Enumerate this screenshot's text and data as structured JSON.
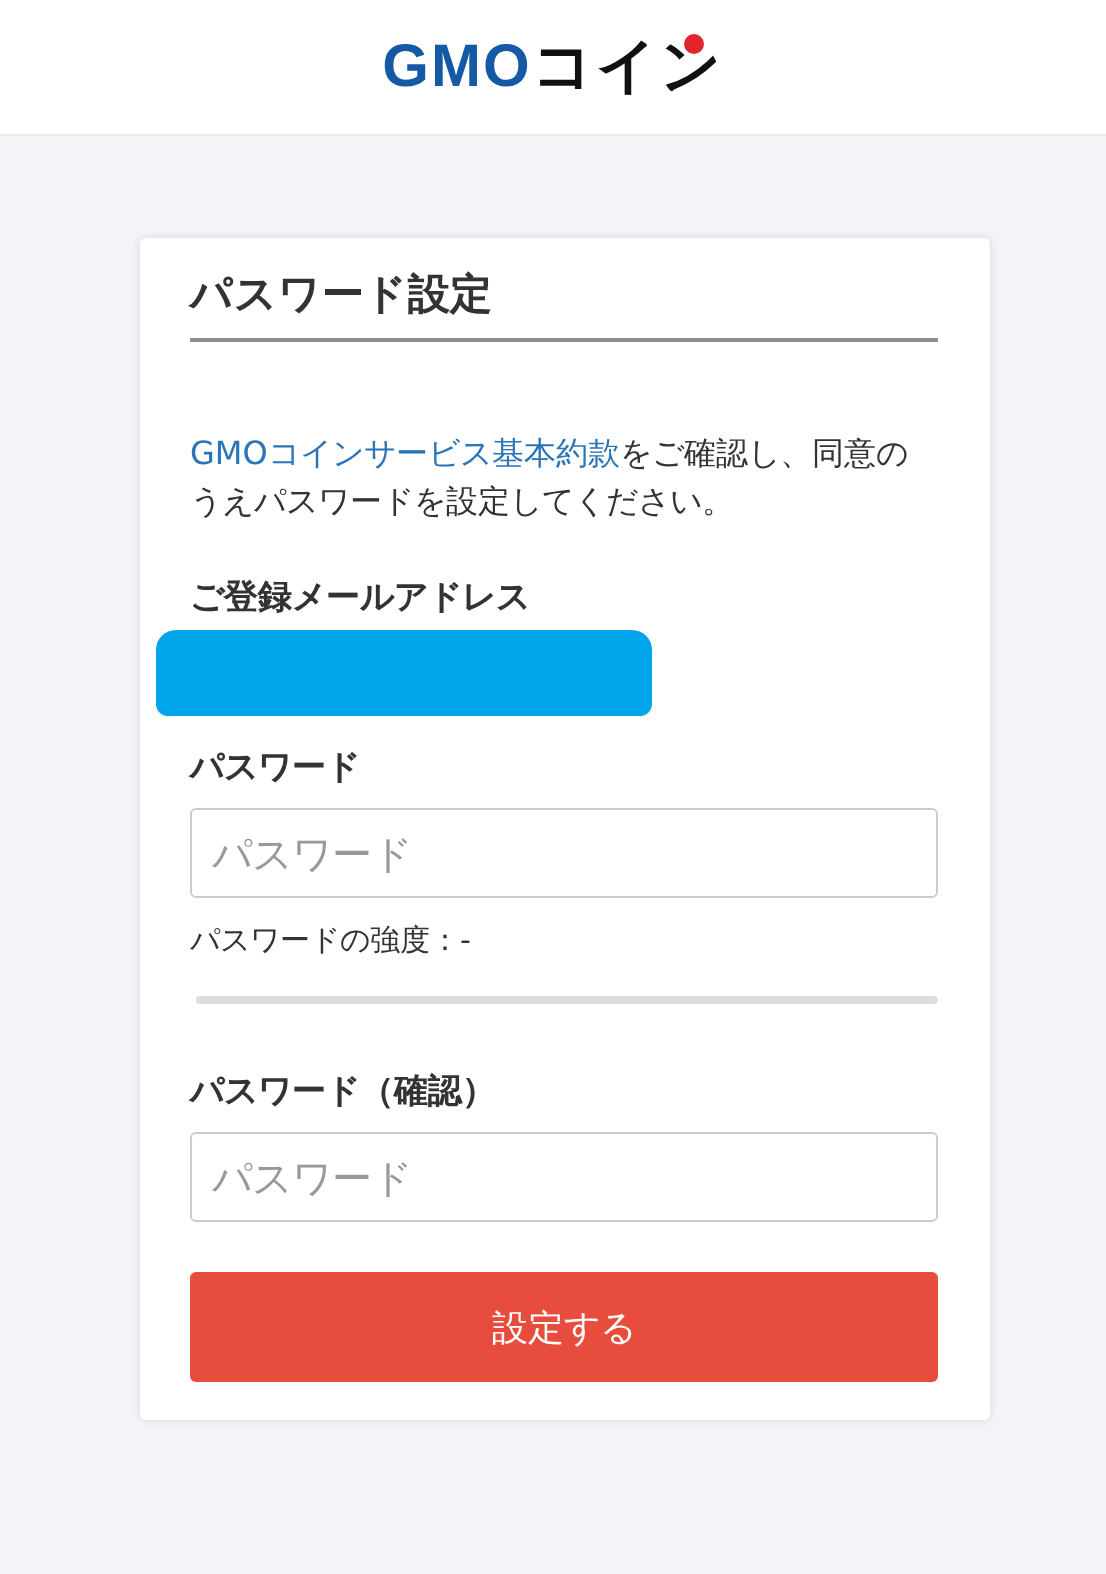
{
  "header": {
    "logo": {
      "brand": "GMO",
      "product": "コイン"
    }
  },
  "card": {
    "title": "パスワード設定",
    "intro": {
      "link": "GMOコインサービス基本約款",
      "text": "をご確認し、同意のうえパスワードを設定してください。"
    },
    "email_label": "ご登録メールアドレス",
    "password": {
      "label": "パスワード",
      "placeholder": "パスワード"
    },
    "strength": {
      "label": "パスワードの強度：-",
      "level": 0
    },
    "password_confirm": {
      "label": "パスワード（確認）",
      "placeholder": "パスワード"
    },
    "submit": "設定する"
  }
}
